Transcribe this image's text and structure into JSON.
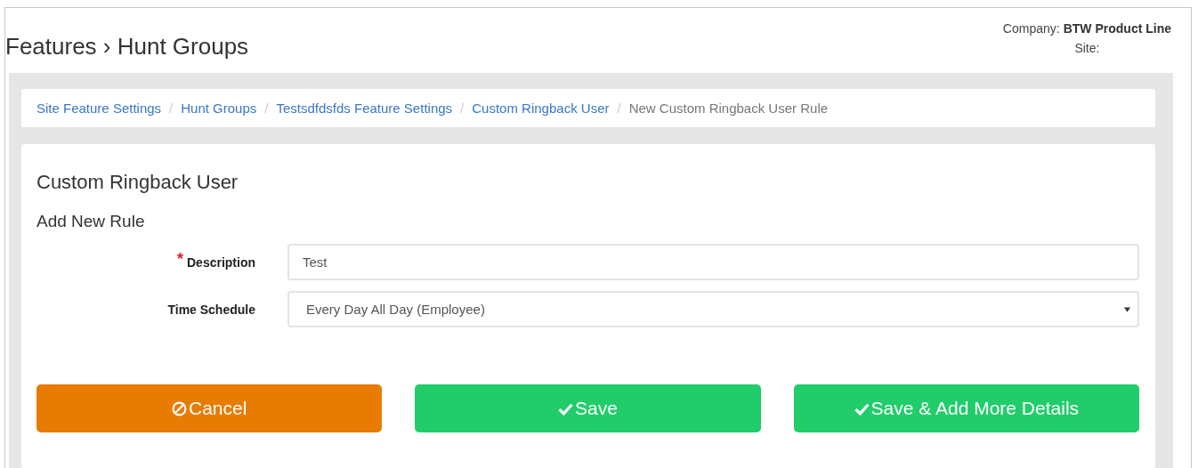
{
  "page_title": {
    "section": "Features",
    "separator": "›",
    "current": "Hunt Groups"
  },
  "context": [
    {
      "label": "Company:",
      "value": "BTW Product Line"
    },
    {
      "label": "Site:"
    }
  ],
  "breadcrumb": [
    {
      "label": "Site Feature Settings",
      "kind": "link"
    },
    {
      "label": "Hunt Groups",
      "kind": "link"
    },
    {
      "label": "Testsdfdsfds Feature Settings",
      "kind": "link"
    },
    {
      "label": "Custom Ringback User",
      "kind": "link"
    },
    {
      "label": "New Custom Ringback User Rule",
      "kind": "current"
    }
  ],
  "breadcrumb_separator": "/",
  "required_mark": "*",
  "card": {
    "title": "Custom Ringback User",
    "subtitle": "Add New Rule"
  },
  "fields": [
    {
      "label": "Description",
      "required": true,
      "kind": "text",
      "value": "Test"
    },
    {
      "label": "Time Schedule",
      "required": false,
      "kind": "select",
      "value": "Every Day All Day (Employee)"
    }
  ],
  "buttons": [
    {
      "label": "Cancel",
      "kind": "cancel"
    },
    {
      "label": "Save",
      "kind": "save"
    },
    {
      "label": "Save & Add More Details",
      "kind": "save"
    }
  ]
}
